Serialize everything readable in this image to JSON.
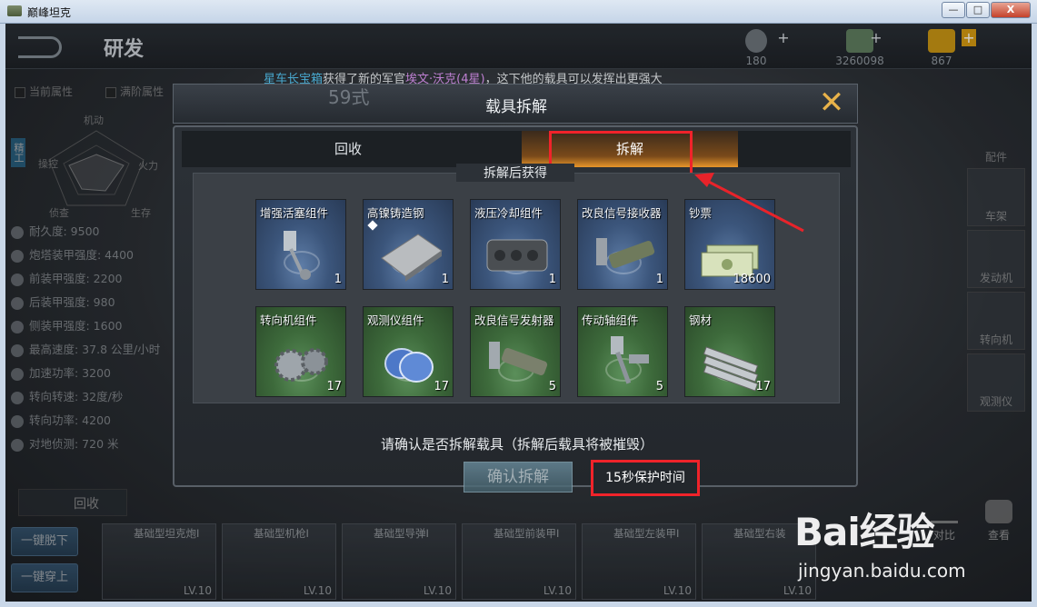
{
  "window": {
    "title": "巅峰坦克",
    "min_label": "—",
    "max_label": "□",
    "close_label": "X"
  },
  "header": {
    "page_title": "研发",
    "resources": [
      {
        "value": "180",
        "color": "#9aa2aa"
      },
      {
        "value": "3260098",
        "color": "#6a9a6a"
      },
      {
        "value": "867",
        "color": "#d8a21a"
      }
    ]
  },
  "broadcast": {
    "part1": "星车长宝箱",
    "part2": "获得了新的军官",
    "part3": "埃文·沃克(4星)",
    "part4": "，这下他的载具可以发挥出更强大"
  },
  "left_panel": {
    "tab_current": "当前属性",
    "tab_full": "满阶属性",
    "elite_tag": "精工",
    "radar_labels": [
      "机动",
      "操控",
      "侦查",
      "生存",
      "火力"
    ],
    "stats": [
      "耐久度: 9500",
      "炮塔装甲强度: 4400",
      "前装甲强度: 2200",
      "后装甲强度: 980",
      "侧装甲强度: 1600",
      "最高速度: 37.8 公里/小时",
      "加速功率: 3200",
      "转向转速: 32度/秒",
      "转向功率: 4200",
      "对地侦测: 720 米"
    ]
  },
  "right_col": {
    "header": "配件",
    "parts": [
      "车架",
      "发动机",
      "转向机",
      "观测仪"
    ]
  },
  "bottom": {
    "recycle_tab": "回收",
    "btn_unequip": "一键脱下",
    "btn_equip": "一键穿上",
    "cards": [
      {
        "name": "基础型坦克炮I",
        "lv": "LV.10"
      },
      {
        "name": "基础型机枪I",
        "lv": "LV.10"
      },
      {
        "name": "基础型导弹I",
        "lv": "LV.10"
      },
      {
        "name": "基础型前装甲I",
        "lv": "LV.10"
      },
      {
        "name": "基础型左装甲I",
        "lv": "LV.10"
      },
      {
        "name": "基础型右装",
        "lv": "LV.10"
      }
    ],
    "compare": "对比",
    "view": "查看"
  },
  "modal": {
    "title": "载具拆解",
    "ghost_text": "59式",
    "close": "✕",
    "tab_recycle": "回收",
    "tab_dismantle": "拆解",
    "obtain_label": "拆解后获得",
    "items": [
      {
        "name": "增强活塞组件",
        "qty": "1",
        "rarity": "blue",
        "icon": "piston-icon"
      },
      {
        "name": "高镍铸造钢",
        "qty": "1",
        "rarity": "blue",
        "icon": "steel-plate-icon"
      },
      {
        "name": "液压冷却组件",
        "qty": "1",
        "rarity": "blue",
        "icon": "engine-block-icon"
      },
      {
        "name": "改良信号接收器",
        "qty": "1",
        "rarity": "blue",
        "icon": "receiver-icon"
      },
      {
        "name": "钞票",
        "qty": "18600",
        "rarity": "blue",
        "icon": "cash-icon"
      },
      {
        "name": "转向机组件",
        "qty": "17",
        "rarity": "green",
        "icon": "gears-icon"
      },
      {
        "name": "观测仪组件",
        "qty": "17",
        "rarity": "green",
        "icon": "lens-icon"
      },
      {
        "name": "改良信号发射器",
        "qty": "5",
        "rarity": "green",
        "icon": "transmitter-icon"
      },
      {
        "name": "传动轴组件",
        "qty": "5",
        "rarity": "green",
        "icon": "shaft-icon"
      },
      {
        "name": "钢材",
        "qty": "17",
        "rarity": "green",
        "icon": "steel-beams-icon"
      }
    ],
    "confirm_text": "请确认是否拆解载具（拆解后载具将被摧毁）",
    "confirm_button": "确认拆解",
    "protect_text": "15秒保护时间"
  },
  "watermark": {
    "logo": "Bai经验",
    "url": "jingyan.baidu.com"
  }
}
